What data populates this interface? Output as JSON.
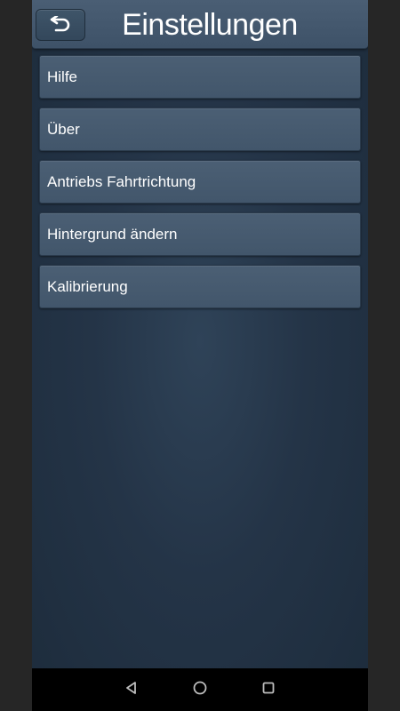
{
  "header": {
    "title": "Einstellungen",
    "back_icon": "back-arrow-icon"
  },
  "menu": {
    "items": [
      {
        "label": "Hilfe"
      },
      {
        "label": "Über"
      },
      {
        "label": "Antriebs Fahrtrichtung"
      },
      {
        "label": "Hintergrund ändern"
      },
      {
        "label": "Kalibrierung"
      }
    ]
  },
  "nav_bar": {
    "icons": [
      "back-triangle-icon",
      "home-circle-icon",
      "recents-square-icon"
    ]
  },
  "colors": {
    "background": "#243447",
    "header": "#44586e",
    "menu_item": "#475b70",
    "text": "#ffffff"
  }
}
